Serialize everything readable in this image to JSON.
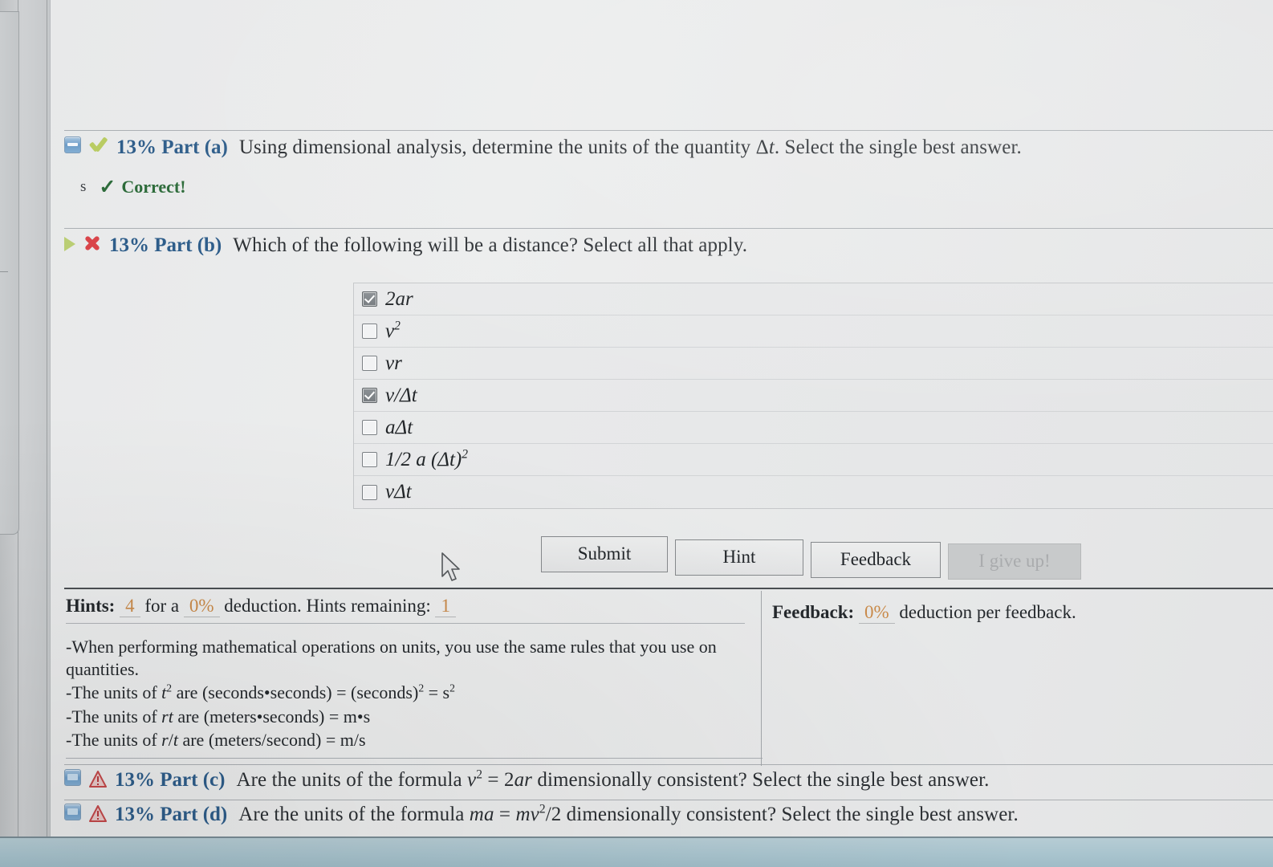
{
  "part_a": {
    "icon": "collapse-box-icon",
    "status_icon": "olive-check-icon",
    "label": "13% Part (a)",
    "question": "Using dimensional analysis, determine the units of the quantity Δt. Select the single best answer.",
    "stray_char": "s",
    "status_text": "Correct!",
    "status_icon_glyph": "✓"
  },
  "part_b": {
    "icon": "expand-triangle-icon",
    "status_icon": "red-x-icon",
    "label": "13% Part (b)",
    "question": "Which of the following will be a distance? Select all that apply.",
    "answers": [
      {
        "checked": true,
        "text_html": "2<i>ar</i>",
        "name": "2ar"
      },
      {
        "checked": false,
        "text_html": "<i>v</i><sup class=\"exp\">2</sup>",
        "name": "v^2"
      },
      {
        "checked": false,
        "text_html": "<i>vr</i>",
        "name": "vr"
      },
      {
        "checked": true,
        "text_html": "<i>v</i>/Δ<i>t</i>",
        "name": "v/dt"
      },
      {
        "checked": false,
        "text_html": "<i>a</i>Δ<i>t</i>",
        "name": "a-dt"
      },
      {
        "checked": false,
        "text_html": "1/2 <i>a</i> (Δ<i>t</i>)<sup class=\"exp\">2</sup>",
        "name": "half-a-dt-squared"
      },
      {
        "checked": false,
        "text_html": "<i>v</i>Δ<i>t</i>",
        "name": "v-dt"
      }
    ]
  },
  "buttons": {
    "submit": "Submit",
    "hint": "Hint",
    "feedback": "Feedback",
    "give_up": "I give up!"
  },
  "hints_panel": {
    "title": "Hints:",
    "count": "4",
    "for_a": "for a",
    "deduction_pct": "0%",
    "deduction_text": "deduction. Hints remaining:",
    "remaining": "1",
    "lines": [
      "-When performing mathematical operations on units, you use the same rules that you use on quantities.",
      "-The units of t² are (seconds•seconds) = (seconds)² = s²",
      "-The units of rt are (meters•seconds) = m•s",
      "-The units of r/t are (meters/second) = m/s"
    ],
    "lines_html": [
      "-When performing mathematical operations on units, you use the same rules that you use on quantities.",
      "-The units of <i>t</i><sup class=\"exp\">2</sup> are (seconds•seconds) = (seconds)<sup class=\"exp\">2</sup> = s<sup class=\"exp\">2</sup>",
      "-The units of <i>rt</i> are (meters•seconds) = m•s",
      "-The units of <i>r</i>/<i>t</i> are (meters/second) = m/s"
    ]
  },
  "feedback_panel": {
    "title": "Feedback:",
    "deduction_pct": "0%",
    "text": "deduction per feedback."
  },
  "part_c": {
    "icon": "collapse-box-icon",
    "status_icon": "warning-triangle-icon",
    "label": "13% Part (c)",
    "question_html": "Are the units of the formula <i>v</i><sup class=\"exp\">2</sup> = 2<i>ar</i> dimensionally consistent? Select the single best answer.",
    "question": "Are the units of the formula v2 = 2ar dimensionally consistent? Select the single best answer."
  },
  "part_d": {
    "icon": "collapse-box-icon",
    "status_icon": "warning-triangle-icon",
    "label": "13% Part (d)",
    "question_html": "Are the units of the formula <i>ma</i> = <i>mv</i><sup class=\"exp\">2</sup>/2 dimensionally consistent? Select the single best answer.",
    "question": "Are the units of the formula ma = mv2/2 dimensionally consistent? Select the single best answer."
  },
  "colors": {
    "part_label": "#2e5d8a",
    "correct_green": "#2d6b3a",
    "olive_check": "#b9cc63",
    "red_x": "#d9454a",
    "warning_red": "#c4484a",
    "number_field": "#c98a4a",
    "page_bg": "#e8e9ea",
    "taskbar": "#a9c4ce"
  }
}
